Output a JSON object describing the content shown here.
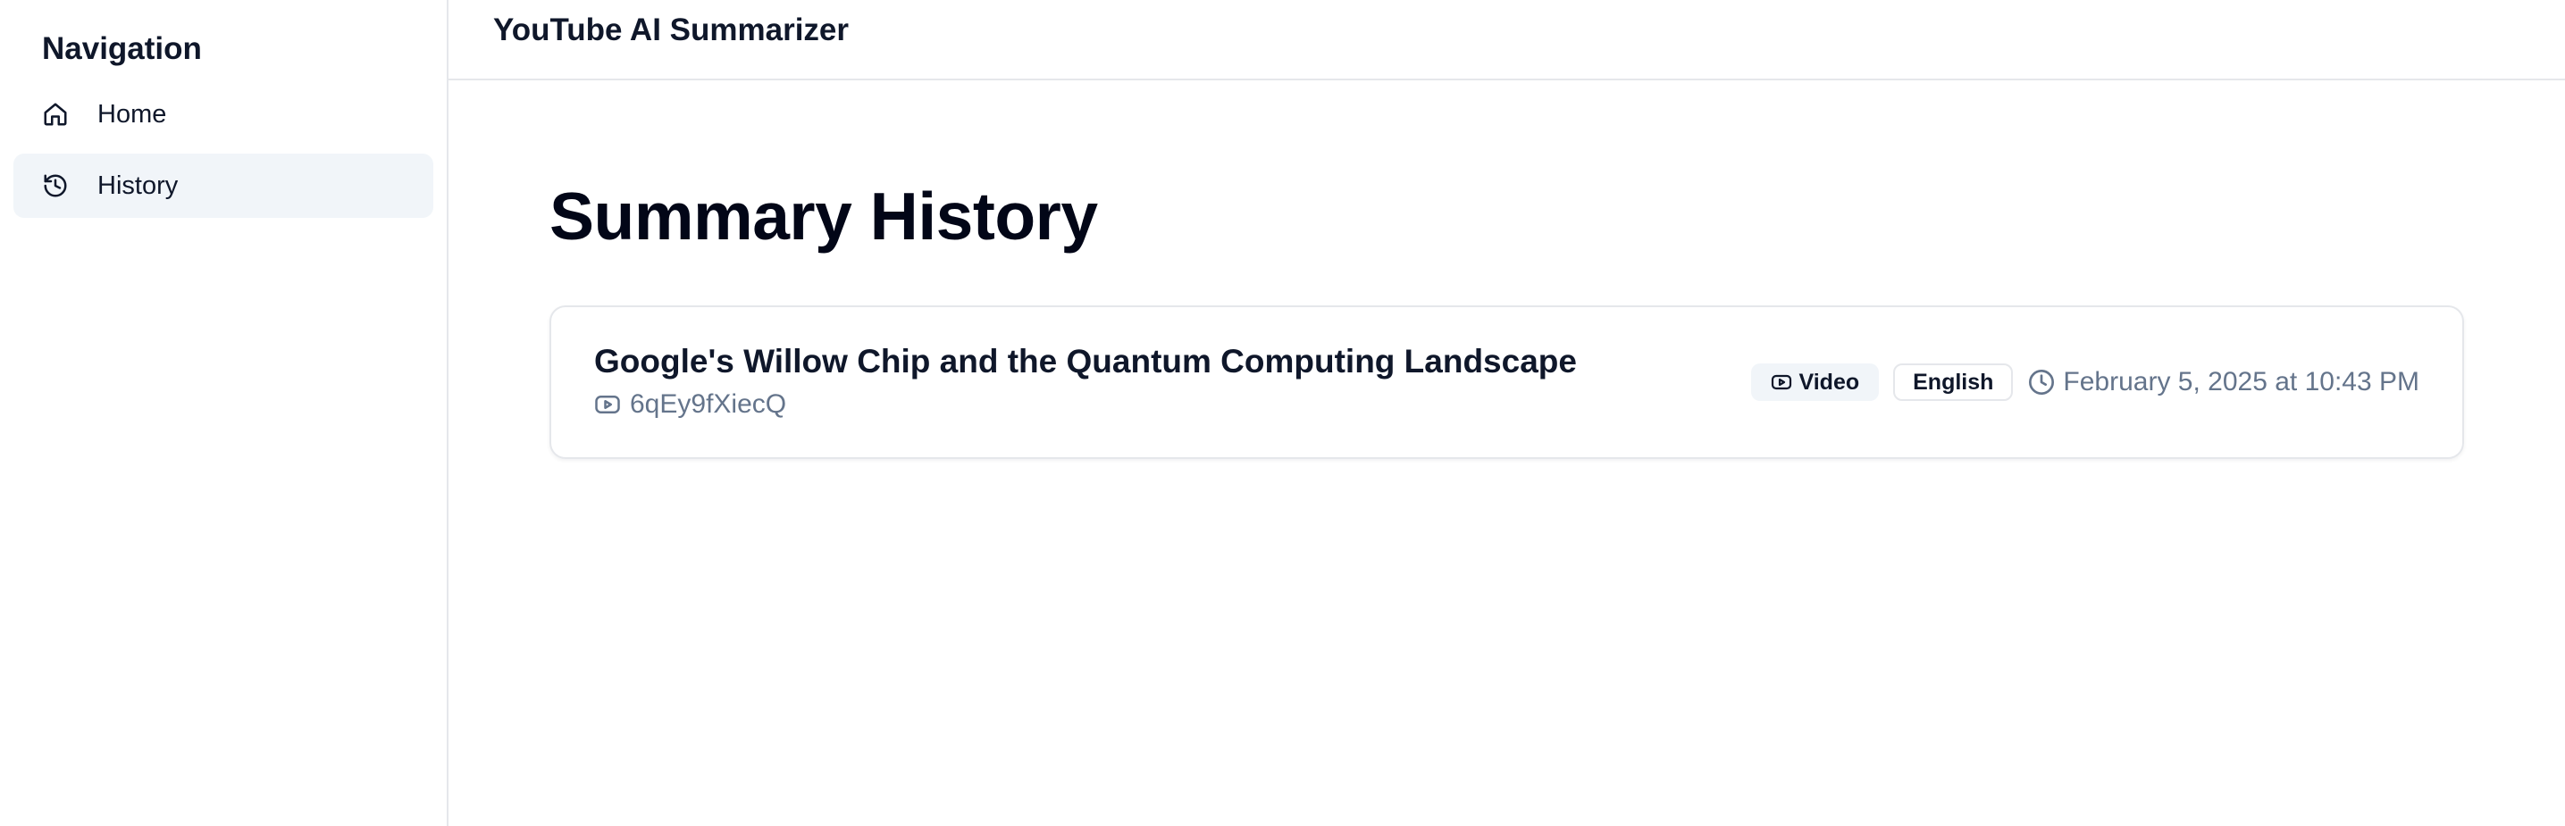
{
  "sidebar": {
    "heading": "Navigation",
    "items": [
      {
        "label": "Home",
        "icon": "home-icon",
        "active": false
      },
      {
        "label": "History",
        "icon": "history-icon",
        "active": true
      }
    ]
  },
  "header": {
    "title": "YouTube AI Summarizer"
  },
  "main": {
    "page_title": "Summary History",
    "summaries": [
      {
        "title": "Google's Willow Chip and the Quantum Computing Landscape",
        "video_id": "6qEy9fXiecQ",
        "type_badge": "Video",
        "language_badge": "English",
        "timestamp": "February 5, 2025 at 10:43 PM"
      }
    ]
  },
  "colors": {
    "text_primary": "#0f172a",
    "text_muted": "#64748b",
    "active_bg": "#f1f5f9",
    "border": "#e5e7eb"
  }
}
